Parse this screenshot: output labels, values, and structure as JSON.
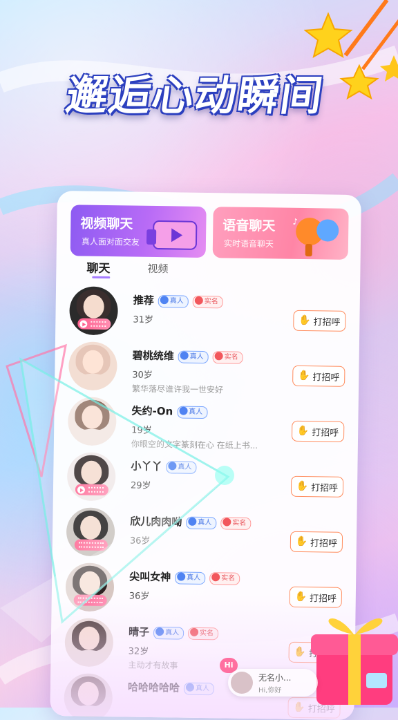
{
  "headline": "邂逅心动瞬间",
  "features": {
    "video": {
      "title": "视频聊天",
      "subtitle": "真人面对面交友"
    },
    "voice": {
      "title": "语音聊天",
      "subtitle": "实时语音聊天"
    }
  },
  "tabs": {
    "chat": "聊天",
    "video": "视频"
  },
  "badges": {
    "real": "真人",
    "named": "实名"
  },
  "greet_label": "打招呼",
  "users": [
    {
      "name": "推荐",
      "age": "31岁",
      "bio": "",
      "real": true,
      "named": true,
      "media": "video"
    },
    {
      "name": "碧桃统维",
      "age": "30岁",
      "bio": "繁华落尽谁许我一世安好",
      "real": true,
      "named": true,
      "media": ""
    },
    {
      "name": "失约-On",
      "age": "19岁",
      "bio": "你眼空的文字篆刻在心 在纸上书...",
      "real": true,
      "named": false,
      "media": ""
    },
    {
      "name": "小丫丫",
      "age": "29岁",
      "bio": "",
      "real": true,
      "named": false,
      "media": "video"
    },
    {
      "name": "欣儿肉肉呦",
      "age": "36岁",
      "bio": "",
      "real": true,
      "named": true,
      "media": "audio"
    },
    {
      "name": "尖叫女神",
      "age": "36岁",
      "bio": "",
      "real": true,
      "named": true,
      "media": "audio"
    },
    {
      "name": "晴子",
      "age": "32岁",
      "bio": "主动才有故事",
      "real": true,
      "named": true,
      "media": ""
    },
    {
      "name": "哈哈哈哈哈",
      "age": "",
      "bio": "",
      "real": true,
      "named": false,
      "media": ""
    }
  ],
  "notification": {
    "bubble": "Hi",
    "title": "无名小...",
    "subtitle": "Hi,你好"
  },
  "colors": {
    "accent": "#a57bff",
    "greet_border": "#ff8c5e",
    "video_card": "#8d5bf2",
    "voice_card": "#ff85a6"
  }
}
